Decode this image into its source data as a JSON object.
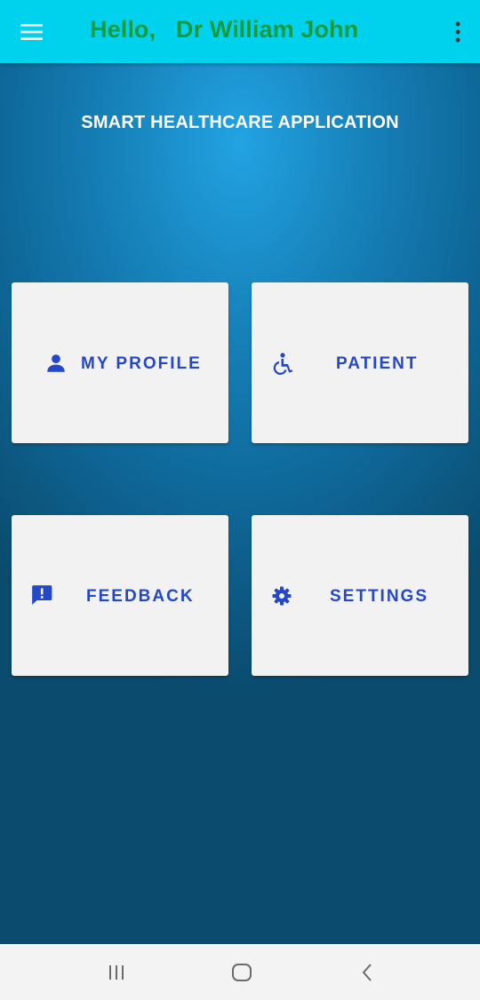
{
  "appbar": {
    "greeting": "Hello,   Dr William John",
    "menu_icon": "hamburger-menu-icon",
    "overflow_icon": "more-vert-icon"
  },
  "main": {
    "title": "SMART HEALTHCARE APPLICATION",
    "tiles": [
      {
        "label": "MY PROFILE",
        "icon": "person-icon"
      },
      {
        "label": "PATIENT",
        "icon": "wheelchair-icon"
      },
      {
        "label": "FEEDBACK",
        "icon": "feedback-icon"
      },
      {
        "label": "SETTINGS",
        "icon": "gear-icon"
      }
    ]
  },
  "navbar": {
    "recents_icon": "recent-apps-icon",
    "home_icon": "home-icon",
    "back_icon": "back-icon"
  },
  "colors": {
    "appbar": "#00d1ec",
    "greeting_text": "#169a3c",
    "tile_background": "#f2f2f2",
    "tile_text": "#2448c8",
    "background_light": "#22a3e2",
    "background_dark": "#0a4b6e"
  }
}
